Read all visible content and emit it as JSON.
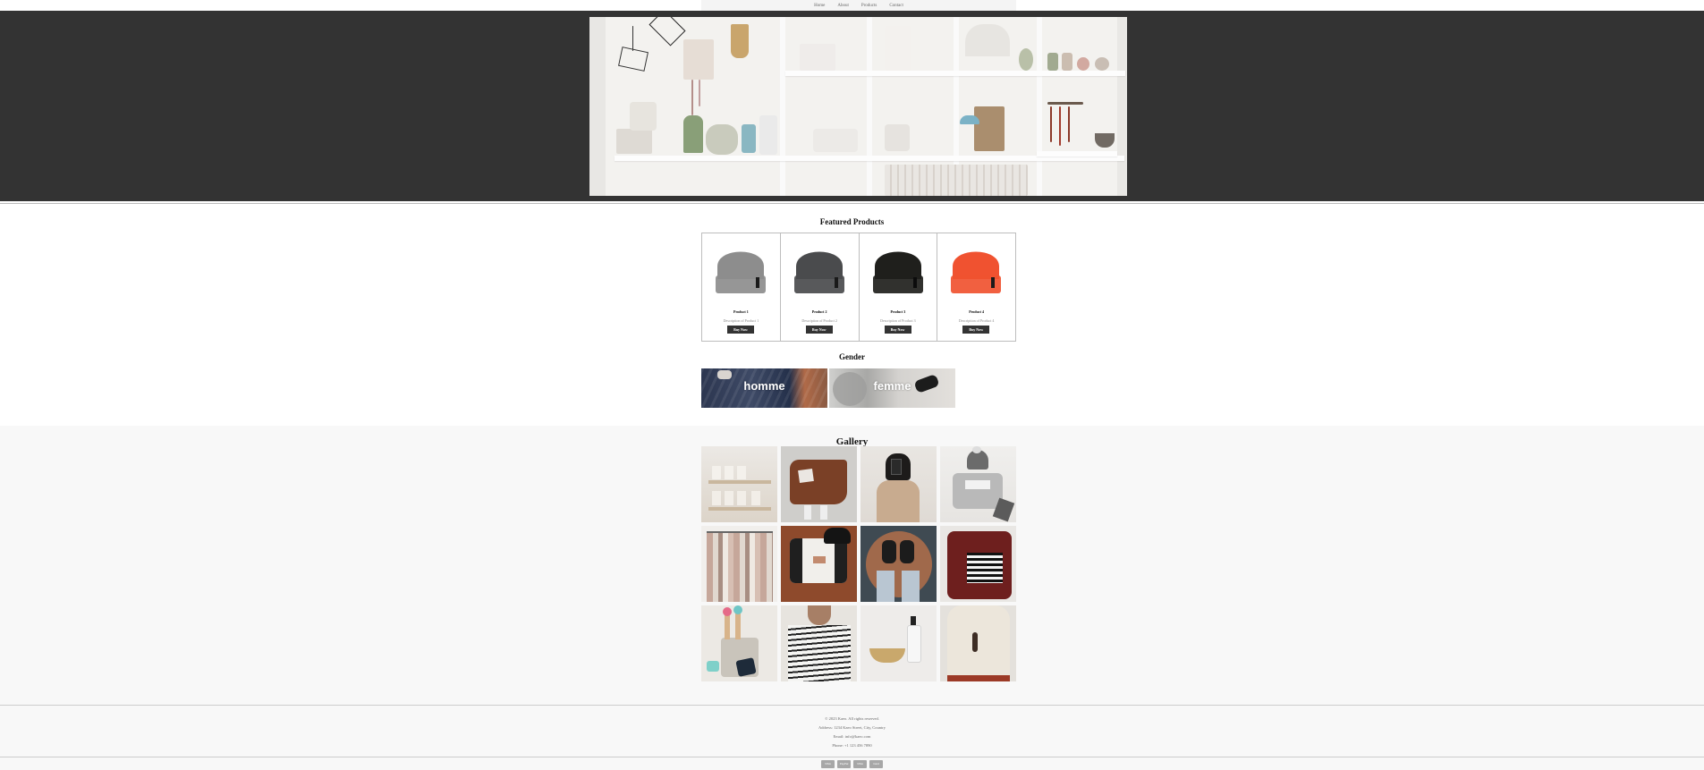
{
  "nav": {
    "items": [
      "Home",
      "About",
      "Products",
      "Contact"
    ]
  },
  "hero": {
    "image_name": "store-shelves"
  },
  "featured": {
    "title": "Featured Products",
    "products": [
      {
        "name": "Product 1",
        "description": "Description of Product 1",
        "button": "Buy Now",
        "color": "#8d8d8d"
      },
      {
        "name": "Product 2",
        "description": "Description of Product 2",
        "button": "Buy Now",
        "color": "#4a4b4d"
      },
      {
        "name": "Product 3",
        "description": "Description of Product 3",
        "button": "Buy Now",
        "color": "#1f1f1c"
      },
      {
        "name": "Product 4",
        "description": "Description of Product 4",
        "button": "Buy Now",
        "color": "#f05230"
      }
    ]
  },
  "gender": {
    "title": "Gender",
    "tiles": [
      {
        "label": "homme"
      },
      {
        "label": "femme"
      }
    ]
  },
  "gallery": {
    "title": "Gallery",
    "images": [
      "candle-shelf",
      "leather-bag",
      "mirror-selfie",
      "beanie-sweater",
      "clothing-rack",
      "shirts-beanie",
      "boots-rug",
      "striped-sweater",
      "jar-items",
      "striped-top",
      "soap-bowl",
      "knit-sweater"
    ]
  },
  "footer": {
    "copyright": "© 2023 Kaeo. All rights reserved.",
    "address": "Address: 1234 Kaeo Street, City, Country",
    "email": "Email: info@kaeo.com",
    "phone": "Phone: +1 123 456 7890",
    "payments": [
      "VISA",
      "PayPal",
      "VISA",
      "Card"
    ]
  },
  "colors": {
    "hero_bg": "#333333",
    "button_bg": "#333333",
    "section_bg": "#f8f8f8"
  }
}
